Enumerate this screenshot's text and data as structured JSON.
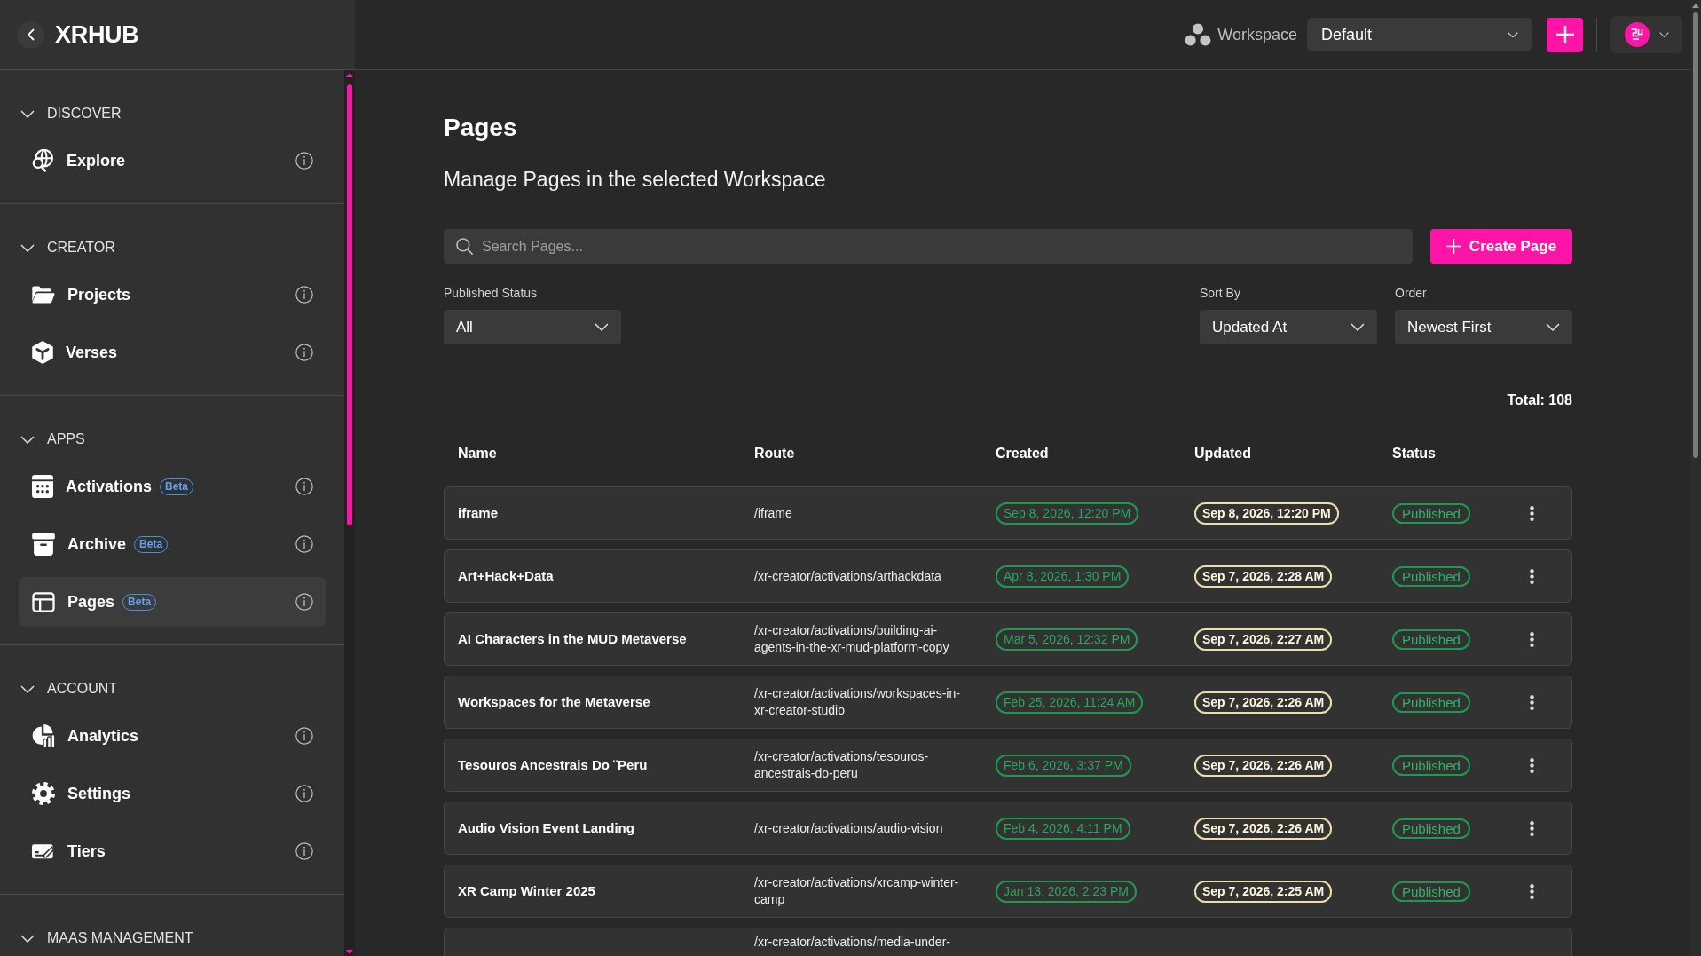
{
  "sidebar": {
    "title": "XRHUB",
    "sections": [
      {
        "title": "DISCOVER",
        "expanded": true,
        "items": [
          {
            "label": "Explore",
            "selected": false
          }
        ]
      },
      {
        "title": "CREATOR",
        "expanded": true,
        "items": [
          {
            "label": "Projects",
            "selected": false
          },
          {
            "label": "Verses",
            "selected": false
          }
        ]
      },
      {
        "title": "APPS",
        "expanded": true,
        "items": [
          {
            "label": "Activations",
            "badge": "Beta",
            "selected": false
          },
          {
            "label": "Archive",
            "badge": "Beta",
            "selected": false
          },
          {
            "label": "Pages",
            "badge": "Beta",
            "selected": true
          }
        ]
      },
      {
        "title": "ACCOUNT",
        "expanded": true,
        "items": [
          {
            "label": "Analytics",
            "selected": false
          },
          {
            "label": "Settings",
            "selected": false
          },
          {
            "label": "Tiers",
            "selected": false
          }
        ]
      },
      {
        "title": "MAAS MANAGEMENT",
        "expanded": true
      }
    ]
  },
  "topbar": {
    "workspace_label": "Workspace",
    "workspace_select": {
      "value": "Default"
    }
  },
  "page": {
    "title": "Pages",
    "subtitle": "Manage Pages in the selected Workspace",
    "search": {
      "placeholder": "Search Pages..."
    },
    "create_button": "Create Page",
    "filters": [
      {
        "label": "Published Status",
        "value": "All"
      },
      {
        "label": "Sort By",
        "value": "Updated At"
      },
      {
        "label": "Order",
        "value": "Newest First"
      }
    ],
    "total": "Total: 108"
  },
  "table": {
    "columns": [
      "Name",
      "Route",
      "Created",
      "Updated",
      "Status"
    ],
    "rows": [
      {
        "name": "iframe",
        "route": "/iframe",
        "created": "Sep 8, 2026, 12:20 PM",
        "updated": "Sep 8, 2026, 12:20 PM",
        "status": "Published"
      },
      {
        "name": "Art+Hack+Data",
        "route": "/xr-creator/activations/arthackdata",
        "created": "Apr 8, 2026, 1:30 PM",
        "updated": "Sep 7, 2026, 2:28 AM",
        "status": "Published"
      },
      {
        "name": "AI Characters in the MUD Metaverse",
        "route": "/xr-creator/activations/building-ai-agents-in-the-xr-mud-platform-copy",
        "created": "Mar 5, 2026, 12:32 PM",
        "updated": "Sep 7, 2026, 2:27 AM",
        "status": "Published"
      },
      {
        "name": "Workspaces for the Metaverse",
        "route": "/xr-creator/activations/workspaces-in-xr-creator-studio",
        "created": "Feb 25, 2026, 11:24 AM",
        "updated": "Sep 7, 2026, 2:26 AM",
        "status": "Published"
      },
      {
        "name": "Tesouros Ancestrais Do ¨Peru",
        "route": "/xr-creator/activations/tesouros-ancestrais-do-peru",
        "created": "Feb 6, 2026, 3:37 PM",
        "updated": "Sep 7, 2026, 2:26 AM",
        "status": "Published"
      },
      {
        "name": "Audio Vision Event Landing",
        "route": "/xr-creator/activations/audio-vision",
        "created": "Feb 4, 2026, 4:11 PM",
        "updated": "Sep 7, 2026, 2:26 AM",
        "status": "Published"
      },
      {
        "name": "XR Camp Winter 2025",
        "route": "/xr-creator/activations/xrcamp-winter-camp",
        "created": "Jan 13, 2026, 2:23 PM",
        "updated": "Sep 7, 2026, 2:25 AM",
        "status": "Published"
      },
      {
        "route": "/xr-creator/activations/media-under-"
      }
    ]
  }
}
